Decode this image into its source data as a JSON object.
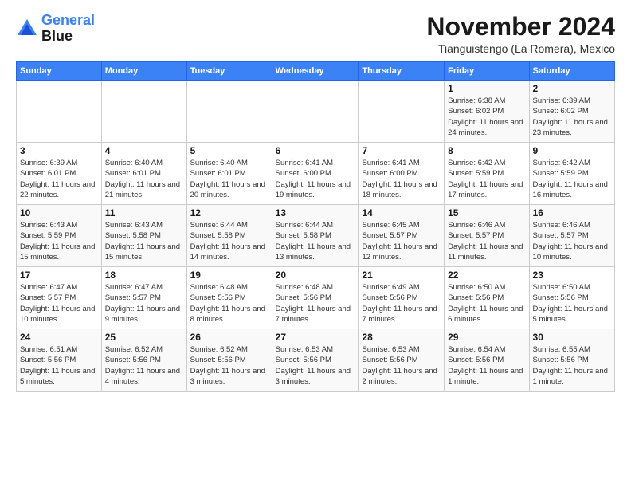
{
  "logo": {
    "line1": "General",
    "line2": "Blue"
  },
  "title": "November 2024",
  "subtitle": "Tianguistengo (La Romera), Mexico",
  "weekdays": [
    "Sunday",
    "Monday",
    "Tuesday",
    "Wednesday",
    "Thursday",
    "Friday",
    "Saturday"
  ],
  "weeks": [
    [
      {
        "day": "",
        "sunrise": "",
        "sunset": "",
        "daylight": ""
      },
      {
        "day": "",
        "sunrise": "",
        "sunset": "",
        "daylight": ""
      },
      {
        "day": "",
        "sunrise": "",
        "sunset": "",
        "daylight": ""
      },
      {
        "day": "",
        "sunrise": "",
        "sunset": "",
        "daylight": ""
      },
      {
        "day": "",
        "sunrise": "",
        "sunset": "",
        "daylight": ""
      },
      {
        "day": "1",
        "sunrise": "Sunrise: 6:38 AM",
        "sunset": "Sunset: 6:02 PM",
        "daylight": "Daylight: 11 hours and 24 minutes."
      },
      {
        "day": "2",
        "sunrise": "Sunrise: 6:39 AM",
        "sunset": "Sunset: 6:02 PM",
        "daylight": "Daylight: 11 hours and 23 minutes."
      }
    ],
    [
      {
        "day": "3",
        "sunrise": "Sunrise: 6:39 AM",
        "sunset": "Sunset: 6:01 PM",
        "daylight": "Daylight: 11 hours and 22 minutes."
      },
      {
        "day": "4",
        "sunrise": "Sunrise: 6:40 AM",
        "sunset": "Sunset: 6:01 PM",
        "daylight": "Daylight: 11 hours and 21 minutes."
      },
      {
        "day": "5",
        "sunrise": "Sunrise: 6:40 AM",
        "sunset": "Sunset: 6:01 PM",
        "daylight": "Daylight: 11 hours and 20 minutes."
      },
      {
        "day": "6",
        "sunrise": "Sunrise: 6:41 AM",
        "sunset": "Sunset: 6:00 PM",
        "daylight": "Daylight: 11 hours and 19 minutes."
      },
      {
        "day": "7",
        "sunrise": "Sunrise: 6:41 AM",
        "sunset": "Sunset: 6:00 PM",
        "daylight": "Daylight: 11 hours and 18 minutes."
      },
      {
        "day": "8",
        "sunrise": "Sunrise: 6:42 AM",
        "sunset": "Sunset: 5:59 PM",
        "daylight": "Daylight: 11 hours and 17 minutes."
      },
      {
        "day": "9",
        "sunrise": "Sunrise: 6:42 AM",
        "sunset": "Sunset: 5:59 PM",
        "daylight": "Daylight: 11 hours and 16 minutes."
      }
    ],
    [
      {
        "day": "10",
        "sunrise": "Sunrise: 6:43 AM",
        "sunset": "Sunset: 5:59 PM",
        "daylight": "Daylight: 11 hours and 15 minutes."
      },
      {
        "day": "11",
        "sunrise": "Sunrise: 6:43 AM",
        "sunset": "Sunset: 5:58 PM",
        "daylight": "Daylight: 11 hours and 15 minutes."
      },
      {
        "day": "12",
        "sunrise": "Sunrise: 6:44 AM",
        "sunset": "Sunset: 5:58 PM",
        "daylight": "Daylight: 11 hours and 14 minutes."
      },
      {
        "day": "13",
        "sunrise": "Sunrise: 6:44 AM",
        "sunset": "Sunset: 5:58 PM",
        "daylight": "Daylight: 11 hours and 13 minutes."
      },
      {
        "day": "14",
        "sunrise": "Sunrise: 6:45 AM",
        "sunset": "Sunset: 5:57 PM",
        "daylight": "Daylight: 11 hours and 12 minutes."
      },
      {
        "day": "15",
        "sunrise": "Sunrise: 6:46 AM",
        "sunset": "Sunset: 5:57 PM",
        "daylight": "Daylight: 11 hours and 11 minutes."
      },
      {
        "day": "16",
        "sunrise": "Sunrise: 6:46 AM",
        "sunset": "Sunset: 5:57 PM",
        "daylight": "Daylight: 11 hours and 10 minutes."
      }
    ],
    [
      {
        "day": "17",
        "sunrise": "Sunrise: 6:47 AM",
        "sunset": "Sunset: 5:57 PM",
        "daylight": "Daylight: 11 hours and 10 minutes."
      },
      {
        "day": "18",
        "sunrise": "Sunrise: 6:47 AM",
        "sunset": "Sunset: 5:57 PM",
        "daylight": "Daylight: 11 hours and 9 minutes."
      },
      {
        "day": "19",
        "sunrise": "Sunrise: 6:48 AM",
        "sunset": "Sunset: 5:56 PM",
        "daylight": "Daylight: 11 hours and 8 minutes."
      },
      {
        "day": "20",
        "sunrise": "Sunrise: 6:48 AM",
        "sunset": "Sunset: 5:56 PM",
        "daylight": "Daylight: 11 hours and 7 minutes."
      },
      {
        "day": "21",
        "sunrise": "Sunrise: 6:49 AM",
        "sunset": "Sunset: 5:56 PM",
        "daylight": "Daylight: 11 hours and 7 minutes."
      },
      {
        "day": "22",
        "sunrise": "Sunrise: 6:50 AM",
        "sunset": "Sunset: 5:56 PM",
        "daylight": "Daylight: 11 hours and 6 minutes."
      },
      {
        "day": "23",
        "sunrise": "Sunrise: 6:50 AM",
        "sunset": "Sunset: 5:56 PM",
        "daylight": "Daylight: 11 hours and 5 minutes."
      }
    ],
    [
      {
        "day": "24",
        "sunrise": "Sunrise: 6:51 AM",
        "sunset": "Sunset: 5:56 PM",
        "daylight": "Daylight: 11 hours and 5 minutes."
      },
      {
        "day": "25",
        "sunrise": "Sunrise: 6:52 AM",
        "sunset": "Sunset: 5:56 PM",
        "daylight": "Daylight: 11 hours and 4 minutes."
      },
      {
        "day": "26",
        "sunrise": "Sunrise: 6:52 AM",
        "sunset": "Sunset: 5:56 PM",
        "daylight": "Daylight: 11 hours and 3 minutes."
      },
      {
        "day": "27",
        "sunrise": "Sunrise: 6:53 AM",
        "sunset": "Sunset: 5:56 PM",
        "daylight": "Daylight: 11 hours and 3 minutes."
      },
      {
        "day": "28",
        "sunrise": "Sunrise: 6:53 AM",
        "sunset": "Sunset: 5:56 PM",
        "daylight": "Daylight: 11 hours and 2 minutes."
      },
      {
        "day": "29",
        "sunrise": "Sunrise: 6:54 AM",
        "sunset": "Sunset: 5:56 PM",
        "daylight": "Daylight: 11 hours and 1 minute."
      },
      {
        "day": "30",
        "sunrise": "Sunrise: 6:55 AM",
        "sunset": "Sunset: 5:56 PM",
        "daylight": "Daylight: 11 hours and 1 minute."
      }
    ]
  ]
}
